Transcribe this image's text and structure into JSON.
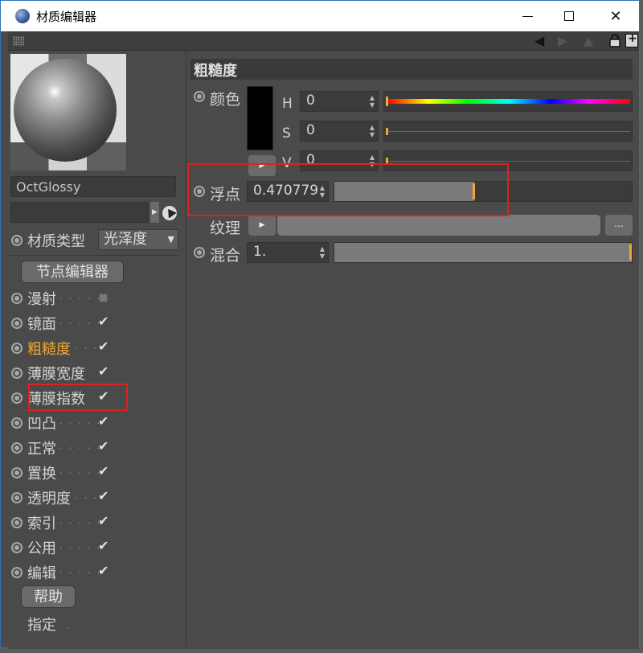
{
  "window": {
    "title": "材质编辑器"
  },
  "material": {
    "name": "OctGlossy"
  },
  "type_row": {
    "label": "材质类型",
    "value": "光泽度"
  },
  "node_editor": {
    "label": "节点编辑器"
  },
  "channels": [
    {
      "label": "漫射",
      "dots": ". . . . . .",
      "checked": false
    },
    {
      "label": "镜面",
      "dots": ". . . . .",
      "checked": true
    },
    {
      "label": "粗糙度",
      "dots": ". . .",
      "checked": true,
      "active": true
    },
    {
      "label": "薄膜宽度",
      "dots": "",
      "checked": true
    },
    {
      "label": "薄膜指数",
      "dots": "",
      "checked": true
    },
    {
      "label": "凹凸",
      "dots": ". . . . .",
      "checked": true
    },
    {
      "label": "正常",
      "dots": ". . . . .",
      "checked": true
    },
    {
      "label": "置换",
      "dots": ". . . . .",
      "checked": true
    },
    {
      "label": "透明度",
      "dots": ". . .",
      "checked": true
    },
    {
      "label": "索引",
      "dots": ". . . . .",
      "checked": true
    },
    {
      "label": "公用",
      "dots": ". . . . .",
      "checked": true
    },
    {
      "label": "编辑",
      "dots": ". . . . .",
      "checked": true
    }
  ],
  "check_glyph": "✔",
  "help": {
    "label": "帮助"
  },
  "assign": {
    "label": "指定"
  },
  "section": {
    "title": "粗糙度"
  },
  "color": {
    "label": "颜色",
    "swatch": "#000000",
    "h_label": "H",
    "h_value": "0",
    "s_label": "S",
    "s_value": "0",
    "v_label": "V",
    "v_value": "0"
  },
  "float": {
    "label": "浮点",
    "value": "0.470779",
    "fraction": 0.470779
  },
  "texture": {
    "label": "纹理",
    "more": "..."
  },
  "mix": {
    "label": "混合",
    "value": "1.",
    "fraction": 1.0
  },
  "colors": {
    "accent": "#f0a830",
    "highlight": "#e02020"
  }
}
